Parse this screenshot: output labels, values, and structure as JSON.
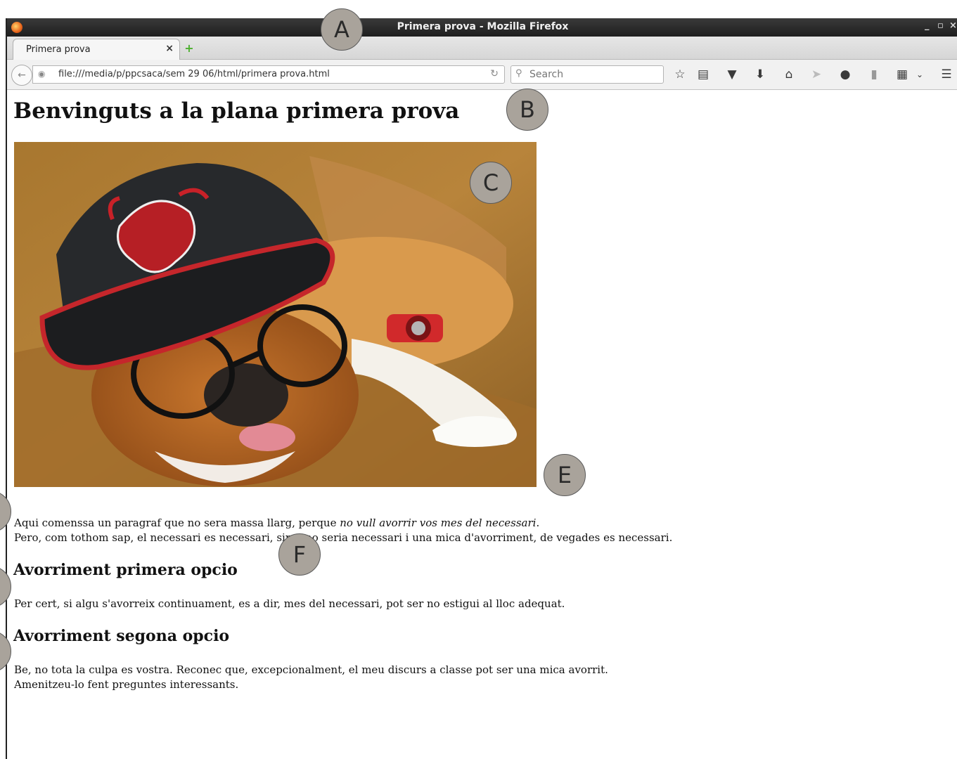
{
  "window": {
    "title": "Primera prova - Mozilla Firefox",
    "controls": [
      "_",
      "▫",
      "×"
    ]
  },
  "tab": {
    "label": "Primera prova",
    "close": "×",
    "new_tab": "+"
  },
  "navbar": {
    "url": "file:///media/p/ppcsaca/sem 29 06/html/primera prova.html",
    "search_placeholder": "Search"
  },
  "toolbar_icons": [
    "bookmark-star-icon",
    "reading-list-icon",
    "pocket-icon",
    "download-icon",
    "home-icon",
    "send-icon",
    "chat-icon",
    "addon-icon",
    "sidebar-icon",
    "chevron-down-icon",
    "menu-icon"
  ],
  "page": {
    "heading": "Benvinguts a la plana primera prova",
    "image_description": "bulldog-with-cap-and-glasses",
    "paragraph1": {
      "line1_normal": "Aqui comenssa un paragraf que no sera massa llarg, perque ",
      "line1_italic": "no vull avorrir vos mes del necessari",
      "line1_end": ".",
      "line2": "Pero, com tothom sap, el necessari es necessari, sino, no seria necessari i una mica d'avorriment, de vegades es necessari."
    },
    "section1": {
      "heading": "Avorriment primera opcio",
      "text": "Per cert, si algu s'avorreix continuament, es a dir, mes del necessari, pot ser no estigui al lloc adequat."
    },
    "section2": {
      "heading": "Avorriment segona opcio",
      "line1": "Be, no tota la culpa es vostra. Reconec que, excepcionalment, el meu discurs a classe pot ser una mica avorrit.",
      "line2": "Amenitzeu-lo fent preguntes interessants."
    }
  },
  "annotations": [
    "A",
    "B",
    "C",
    "E",
    "F"
  ]
}
